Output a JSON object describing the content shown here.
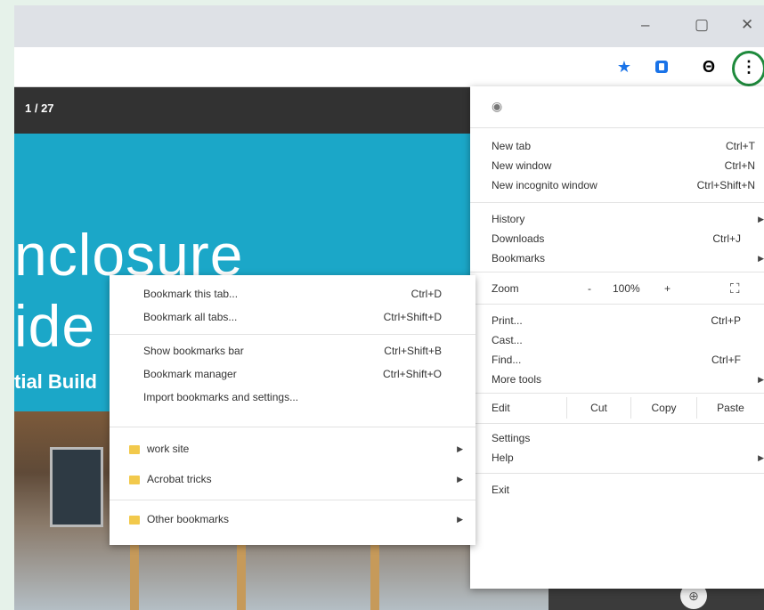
{
  "window_controls": {
    "minimize": "–",
    "maximize": "▢",
    "close": "✕"
  },
  "toolbar": {
    "icons": [
      "star-icon",
      "shield-extension-icon",
      "account-icon",
      "kebab-menu-icon"
    ],
    "star": "★",
    "account": "Θ",
    "kebab": "⋮",
    "accent": "#1a73e8",
    "highlight_color": "#1e8a3c"
  },
  "pdf": {
    "page_count": "1 / 27",
    "title_line1": "nclosure",
    "title_line2": "ide",
    "subtitle": "tial Build",
    "cover_color": "#1ba7c8"
  },
  "chrome_menu": {
    "header_icon": "incognito-icon",
    "header_glyph": "◉",
    "items_top": [
      {
        "label": "New tab",
        "shortcut": "Ctrl+T"
      },
      {
        "label": "New window",
        "shortcut": "Ctrl+N"
      },
      {
        "label": "New incognito window",
        "shortcut": "Ctrl+Shift+N"
      }
    ],
    "items_mid": [
      {
        "label": "History",
        "shortcut": ""
      },
      {
        "label": "Downloads",
        "shortcut": "Ctrl+J"
      },
      {
        "label": "Bookmarks",
        "shortcut": ""
      }
    ],
    "zoom": {
      "label": "Zoom",
      "minus": "-",
      "value": "100%",
      "plus": "+",
      "fullscreen": "⛶"
    },
    "items_tools": [
      {
        "label": "Print...",
        "shortcut": "Ctrl+P"
      },
      {
        "label": "Cast...",
        "shortcut": ""
      },
      {
        "label": "Find...",
        "shortcut": "Ctrl+F"
      },
      {
        "label": "More tools",
        "shortcut": ""
      }
    ],
    "edit": {
      "label": "Edit",
      "cut": "Cut",
      "copy": "Copy",
      "paste": "Paste"
    },
    "settings": "Settings",
    "help": "Help",
    "exit": "Exit"
  },
  "bookmarks_menu": {
    "items_top": [
      {
        "label": "Bookmark this tab...",
        "shortcut": "Ctrl+D"
      },
      {
        "label": "Bookmark all tabs...",
        "shortcut": "Ctrl+Shift+D"
      }
    ],
    "items_mid": [
      {
        "label": "Show bookmarks bar",
        "shortcut": "Ctrl+Shift+B"
      },
      {
        "label": "Bookmark manager",
        "shortcut": "Ctrl+Shift+O"
      },
      {
        "label": "Import bookmarks and settings...",
        "shortcut": ""
      }
    ],
    "folders": [
      {
        "label": "work site"
      },
      {
        "label": "Acrobat tricks"
      }
    ],
    "other": {
      "label": "Other bookmarks"
    },
    "folder_color": "#f2c94c"
  },
  "fab_glyph": "⊕"
}
